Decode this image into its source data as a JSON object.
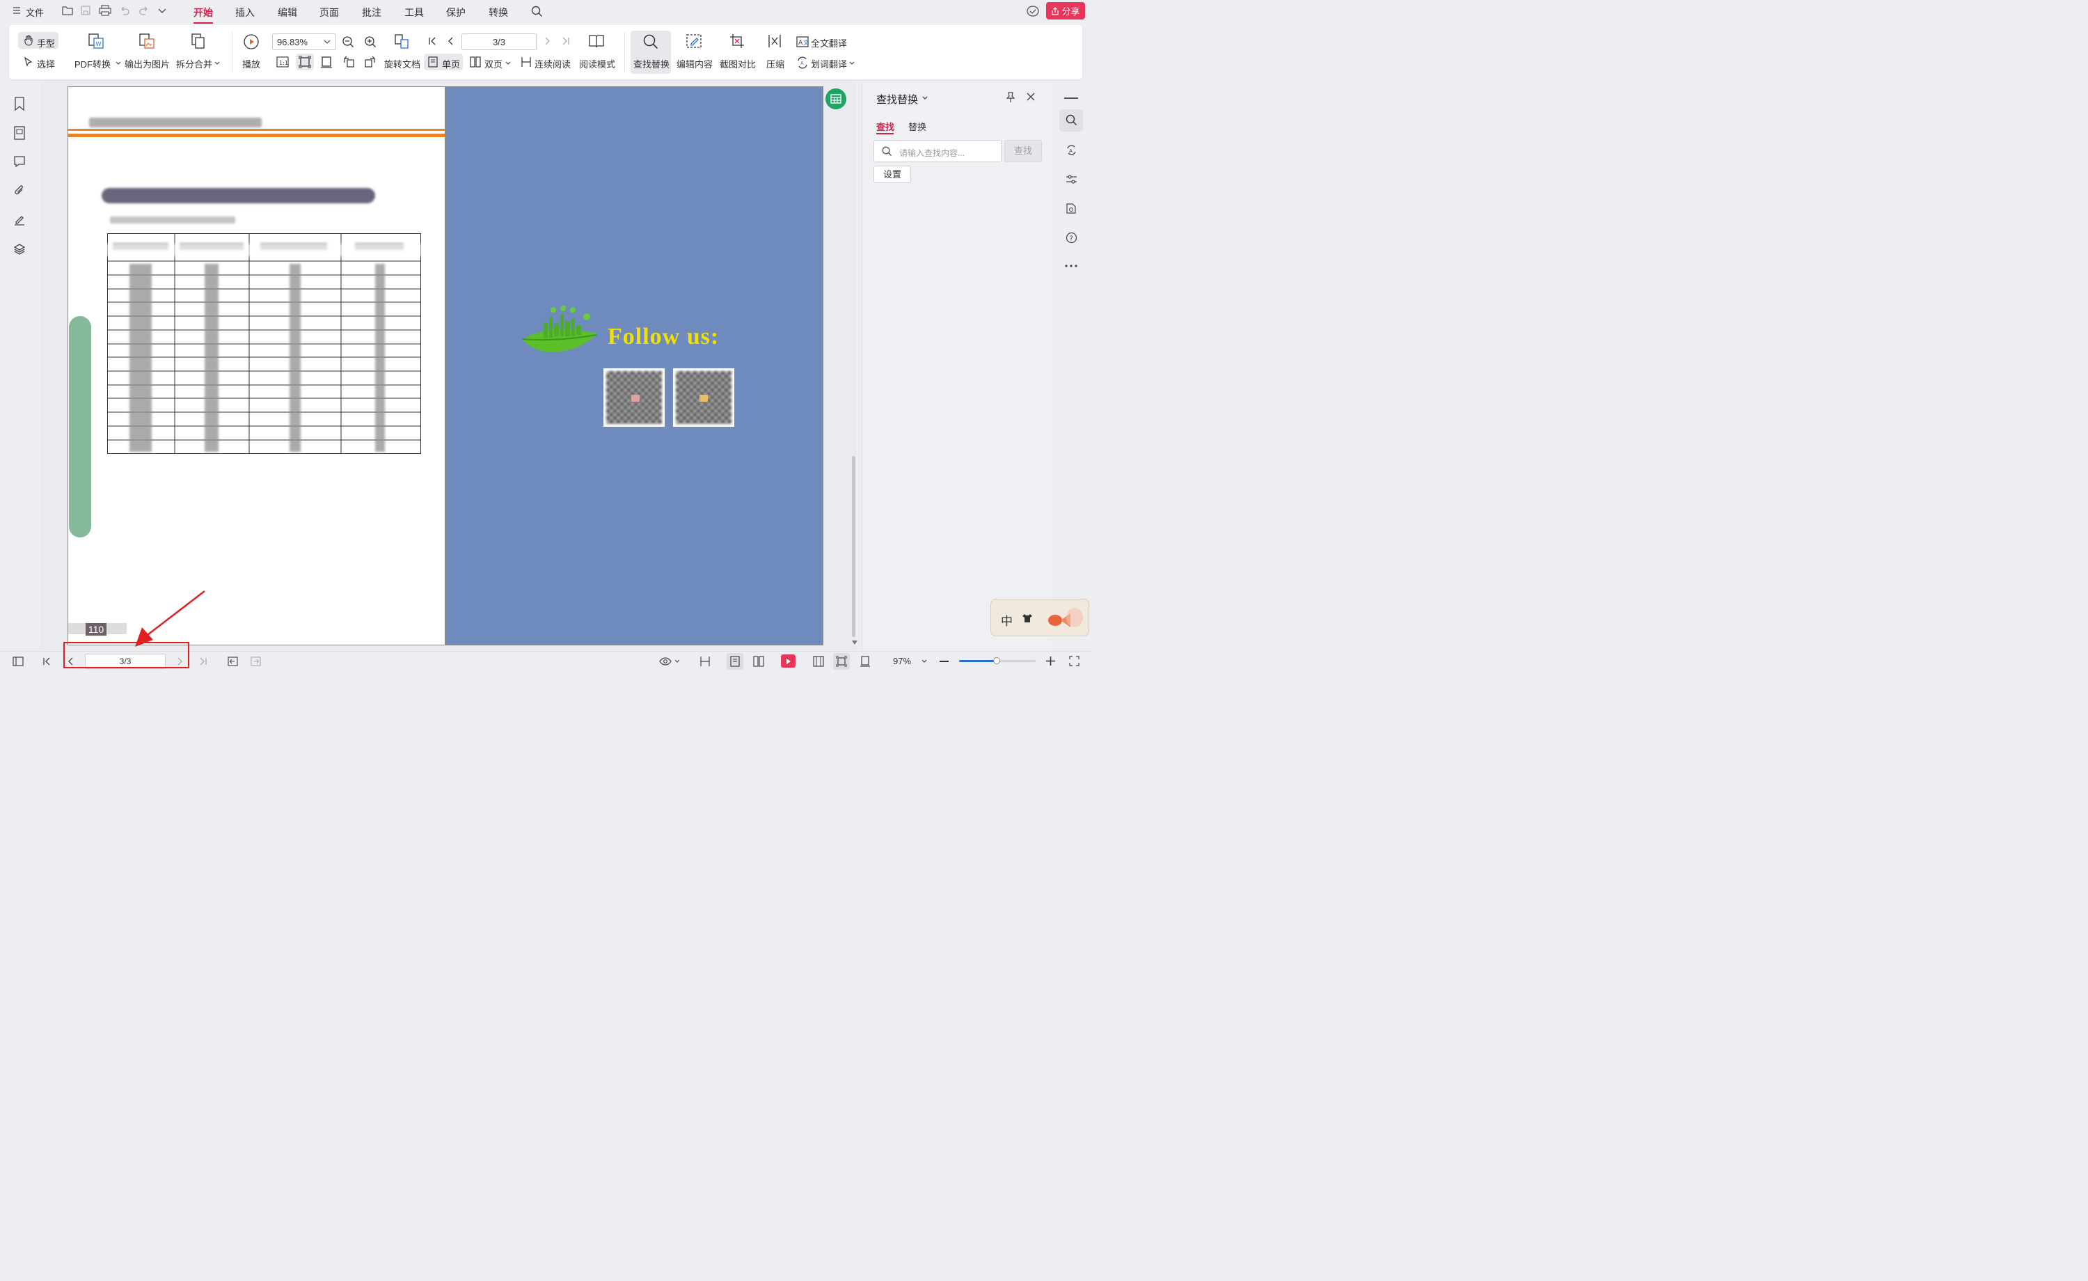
{
  "menubar": {
    "file_label": "文件",
    "tabs": [
      {
        "label": "开始"
      },
      {
        "label": "插入"
      },
      {
        "label": "编辑"
      },
      {
        "label": "页面"
      },
      {
        "label": "批注"
      },
      {
        "label": "工具"
      },
      {
        "label": "保护"
      },
      {
        "label": "转换"
      }
    ],
    "share_label": "分享"
  },
  "ribbon": {
    "hand_label": "手型",
    "select_label": "选择",
    "pdf_convert_label": "PDF转换",
    "export_image_label": "输出为图片",
    "split_merge_label": "拆分合并",
    "play_label": "播放",
    "zoom_value": "96.83%",
    "page_value": "3/3",
    "rotate_doc_label": "旋转文档",
    "single_page_label": "单页",
    "double_page_label": "双页",
    "continuous_label": "连续阅读",
    "read_mode_label": "阅读模式",
    "find_replace_label": "查找替换",
    "edit_content_label": "编辑内容",
    "screenshot_compare_label": "截图对比",
    "compress_label": "压缩",
    "full_translate_label": "全文翻译",
    "word_translate_label": "划词翻译",
    "actual_size_glyph": "1:1"
  },
  "document": {
    "right_page": {
      "follow_text": "Follow us:"
    },
    "left_page": {
      "page_number": "110"
    }
  },
  "find_panel": {
    "title": "查找替换",
    "tab_find": "查找",
    "tab_replace": "替换",
    "search_placeholder": "请输入查找内容...",
    "find_button": "查找",
    "settings_button": "设置"
  },
  "statusbar": {
    "page_value": "3/3",
    "zoom_value": "97%"
  },
  "ime": {
    "label": "中"
  },
  "colors": {
    "accent": "#d6204a",
    "page_blue": "#6f8abd",
    "follow_yellow": "#f2e000",
    "leaf_green": "#5bbf2a",
    "sidebar_green": "#86b89c",
    "orange_line": "#e8842a",
    "annotation_red": "#e02020"
  }
}
